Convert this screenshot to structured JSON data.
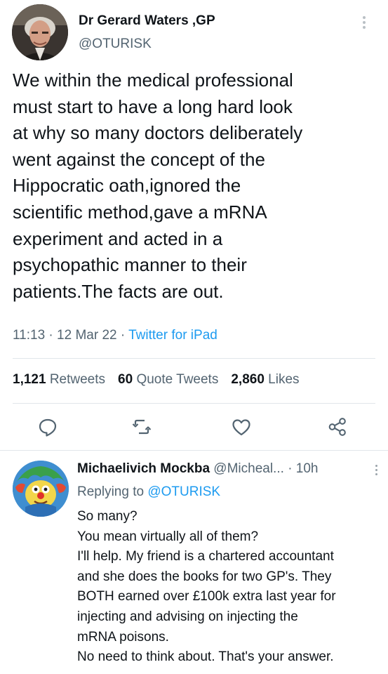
{
  "tweet": {
    "author_name": "Dr Gerard Waters ,GP",
    "author_handle": "@OTURISK",
    "text": "We within the medical professional\nmust start to have a long hard look\nat why so many doctors deliberately\nwent against the concept of the\nHippocratic oath,ignored the\nscientific method,gave a mRNA\nexperiment and acted in a\npsychopathic manner to their\npatients.The facts are out.",
    "time": "11:13",
    "date": "12 Mar 22",
    "separator": "·",
    "source": "Twitter for iPad"
  },
  "stats": {
    "retweets_count": "1,121",
    "retweets_label": "Retweets",
    "quotes_count": "60",
    "quotes_label": "Quote Tweets",
    "likes_count": "2,860",
    "likes_label": "Likes"
  },
  "actions": [
    {
      "icon": "reply-icon"
    },
    {
      "icon": "retweet-icon"
    },
    {
      "icon": "like-icon"
    },
    {
      "icon": "share-icon"
    }
  ],
  "reply": {
    "author_name": "Michaelivich Mockba",
    "author_handle": "@Micheal...",
    "time": "· 10h",
    "replying_prefix": "Replying to",
    "replying_handle": "@OTURISK",
    "text": "So many?\nYou mean virtually all of them?\nI'll help. My friend is a chartered accountant\nand she does the books for two GP's. They\nBOTH earned over £100k extra last year for\ninjecting and advising on injecting the\nmRNA poisons.\nNo need to think about. That's your answer."
  },
  "colors": {
    "text": "#0f1419",
    "secondary": "#536471",
    "link": "#1d9bf0",
    "divider": "#e1e6ea"
  }
}
